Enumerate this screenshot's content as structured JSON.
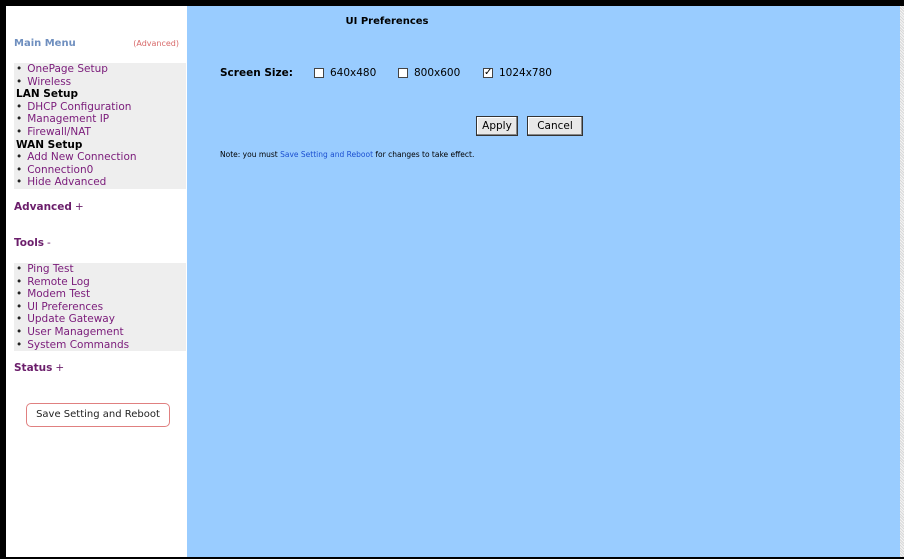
{
  "sidebar": {
    "main_menu_title": "Main Menu",
    "main_menu_mode": "(Advanced)",
    "main_items": [
      {
        "type": "link",
        "label": "OnePage Setup"
      },
      {
        "type": "link",
        "label": "Wireless"
      },
      {
        "type": "header",
        "label": "LAN Setup"
      },
      {
        "type": "link",
        "label": "DHCP Configuration"
      },
      {
        "type": "link",
        "label": "Management IP"
      },
      {
        "type": "link",
        "label": "Firewall/NAT"
      },
      {
        "type": "header",
        "label": "WAN Setup"
      },
      {
        "type": "link",
        "label": "Add New Connection"
      },
      {
        "type": "link",
        "label": "Connection0"
      },
      {
        "type": "link",
        "label": "Hide Advanced"
      }
    ],
    "advanced_title": "Advanced",
    "advanced_symbol": "+",
    "tools_title": "Tools",
    "tools_symbol": "-",
    "tools_items": [
      "Ping Test",
      "Remote Log",
      "Modem Test",
      "UI Preferences",
      "Update Gateway",
      "User Management",
      "System Commands"
    ],
    "status_title": "Status",
    "status_symbol": "+",
    "save_reboot_label": "Save Setting and Reboot"
  },
  "main": {
    "title": "UI Preferences",
    "screen_size_label": "Screen Size:",
    "options": [
      {
        "label": "640x480",
        "checked": false
      },
      {
        "label": "800x600",
        "checked": false
      },
      {
        "label": "1024x780",
        "checked": true
      }
    ],
    "apply_label": "Apply",
    "cancel_label": "Cancel",
    "note_prefix": "Note: you must ",
    "note_link": "Save Setting and Reboot",
    "note_suffix": " for changes to take effect."
  },
  "colors": {
    "main_bg": "#99ccff",
    "link": "#7a1b7a",
    "menu_bg": "#eeeeee"
  }
}
